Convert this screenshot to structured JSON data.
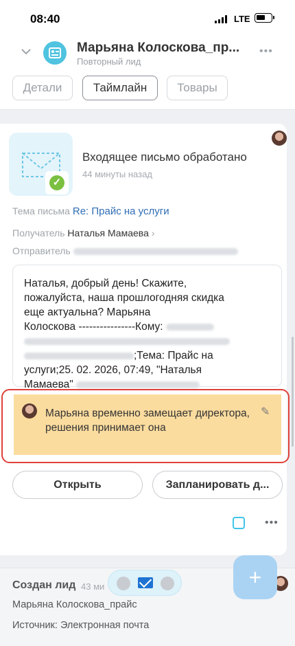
{
  "status_bar": {
    "time": "08:40",
    "network": "LTE"
  },
  "header": {
    "title": "Марьяна Колоскова_пр...",
    "subtitle": "Повторный лид",
    "more": "•••"
  },
  "tabs": [
    {
      "label": "Детали",
      "active": false
    },
    {
      "label": "Таймлайн",
      "active": true
    },
    {
      "label": "Товары",
      "active": false
    }
  ],
  "event": {
    "title": "Входящее письмо обработано",
    "time": "44 минуты назад",
    "subject_label": "Тема письма",
    "subject_value": "Re: Прайс на услуги",
    "recipient_label": "Получатель",
    "recipient_value": "Наталья Мамаева",
    "sender_label": "Отправитель",
    "message_line1": "Наталья, добрый день! Скажите,",
    "message_line2": "пожалуйста, наша прошлогодняя скидка",
    "message_line3": "еще актуальна? Марьяна",
    "message_line4": "Колоскова ----------------Кому:",
    "message_line5": ";Тема: Прайс на",
    "message_line6": "услуги;25. 02. 2026, 07:49, \"Наталья",
    "message_line7": "Мамаева\""
  },
  "note": {
    "text": "Марьяна временно замещает директора, решения принимает она"
  },
  "buttons": {
    "open": "Открыть",
    "schedule": "Запланировать д..."
  },
  "card2": {
    "title": "Создан лид",
    "time": "43 ми",
    "line1": "Марьяна Колоскова_прайс",
    "line2": "Источник: Электронная почта"
  },
  "fab_label": "+",
  "colors": {
    "accent": "#2f6db5",
    "note_bg": "#fbdc9f",
    "highlight": "#e0403a",
    "success": "#7bc041"
  }
}
